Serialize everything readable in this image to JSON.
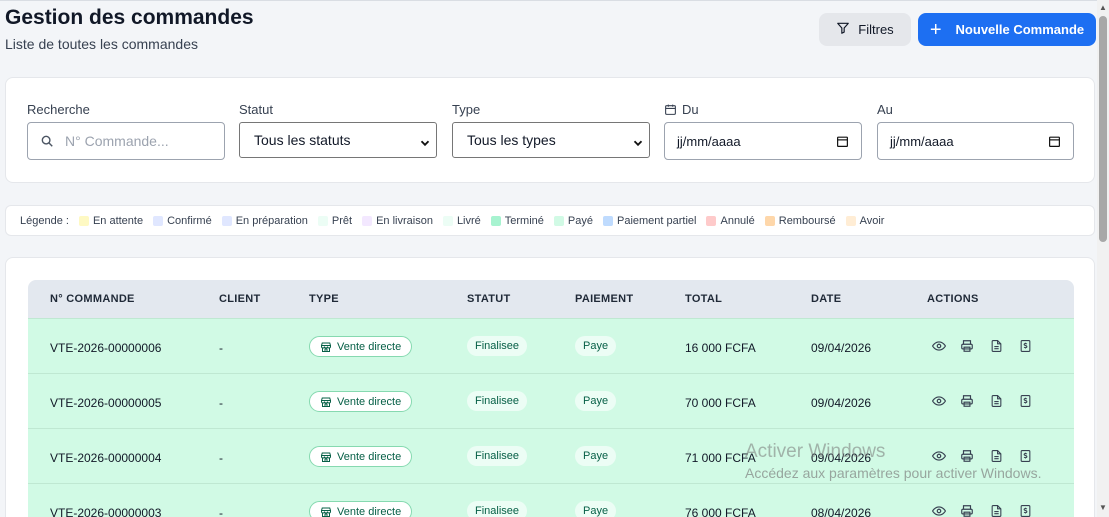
{
  "header": {
    "title": "Gestion des commandes",
    "subtitle": "Liste de toutes les commandes",
    "filter_button": "Filtres",
    "new_button": "Nouvelle Commande"
  },
  "filters": {
    "search": {
      "label": "Recherche",
      "placeholder": "N° Commande..."
    },
    "status": {
      "label": "Statut",
      "value": "Tous les statuts"
    },
    "type": {
      "label": "Type",
      "value": "Tous les types"
    },
    "date_from": {
      "label": "Du",
      "value": "jj/mm/aaaa"
    },
    "date_to": {
      "label": "Au",
      "value": "jj/mm/aaaa"
    }
  },
  "legend": {
    "title": "Légende :",
    "items": [
      {
        "label": "En attente",
        "color": "#fef9c3"
      },
      {
        "label": "Confirmé",
        "color": "#e0e7ff"
      },
      {
        "label": "En préparation",
        "color": "#e0e7ff"
      },
      {
        "label": "Prêt",
        "color": "#ecfdf5"
      },
      {
        "label": "En livraison",
        "color": "#f3e8ff"
      },
      {
        "label": "Livré",
        "color": "#ecfdf5"
      },
      {
        "label": "Terminé",
        "color": "#a7f3d0"
      },
      {
        "label": "Payé",
        "color": "#d1fae5"
      },
      {
        "label": "Paiement partiel",
        "color": "#bfdbfe"
      },
      {
        "label": "Annulé",
        "color": "#fecaca"
      },
      {
        "label": "Remboursé",
        "color": "#fed7aa"
      },
      {
        "label": "Avoir",
        "color": "#ffedd5"
      }
    ]
  },
  "table": {
    "columns": [
      "N° COMMANDE",
      "CLIENT",
      "TYPE",
      "STATUT",
      "PAIEMENT",
      "TOTAL",
      "DATE",
      "ACTIONS"
    ],
    "rows": [
      {
        "number": "VTE-2026-00000006",
        "client": "-",
        "type": "Vente directe",
        "status": "Finalisee",
        "payment": "Paye",
        "total": "16 000 FCFA",
        "date": "09/04/2026"
      },
      {
        "number": "VTE-2026-00000005",
        "client": "-",
        "type": "Vente directe",
        "status": "Finalisee",
        "payment": "Paye",
        "total": "70 000 FCFA",
        "date": "09/04/2026"
      },
      {
        "number": "VTE-2026-00000004",
        "client": "-",
        "type": "Vente directe",
        "status": "Finalisee",
        "payment": "Paye",
        "total": "71 000 FCFA",
        "date": "09/04/2026"
      },
      {
        "number": "VTE-2026-00000003",
        "client": "-",
        "type": "Vente directe",
        "status": "Finalisee",
        "payment": "Paye",
        "total": "76 000 FCFA",
        "date": "08/04/2026"
      }
    ],
    "row_color": "#d1fae5"
  },
  "watermark": {
    "line1": "Activer Windows",
    "line2": "Accédez aux paramètres pour activer Windows."
  },
  "colors": {
    "accent": "#1d6ff2"
  }
}
